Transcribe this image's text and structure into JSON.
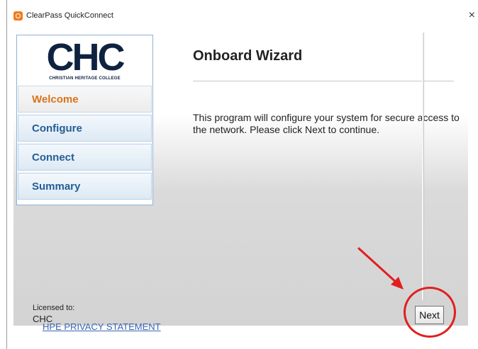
{
  "window": {
    "title": "ClearPass QuickConnect",
    "close_glyph": "×",
    "app_icon": "clearpass-app-icon"
  },
  "sidebar": {
    "logo_text": "CHC",
    "logo_subtitle": "CHRISTIAN HERITAGE COLLEGE",
    "items": [
      {
        "label": "Welcome",
        "state": "active"
      },
      {
        "label": "Configure",
        "state": "inactive"
      },
      {
        "label": "Connect",
        "state": "inactive"
      },
      {
        "label": "Summary",
        "state": "inactive"
      }
    ]
  },
  "main": {
    "heading": "Onboard Wizard",
    "description": "This program will configure your system for secure access to the network. Please click Next to continue."
  },
  "footer": {
    "licensed_label": "Licensed to:",
    "licensed_value": "CHC",
    "privacy_link": "HPE PRIVACY STATEMENT",
    "next_label": "Next"
  },
  "colors": {
    "accent_orange": "#d9731a",
    "nav_blue": "#245e96",
    "link_blue": "#3a66b3",
    "annotation_red": "#e01f1f",
    "logo_navy": "#0e2240"
  }
}
